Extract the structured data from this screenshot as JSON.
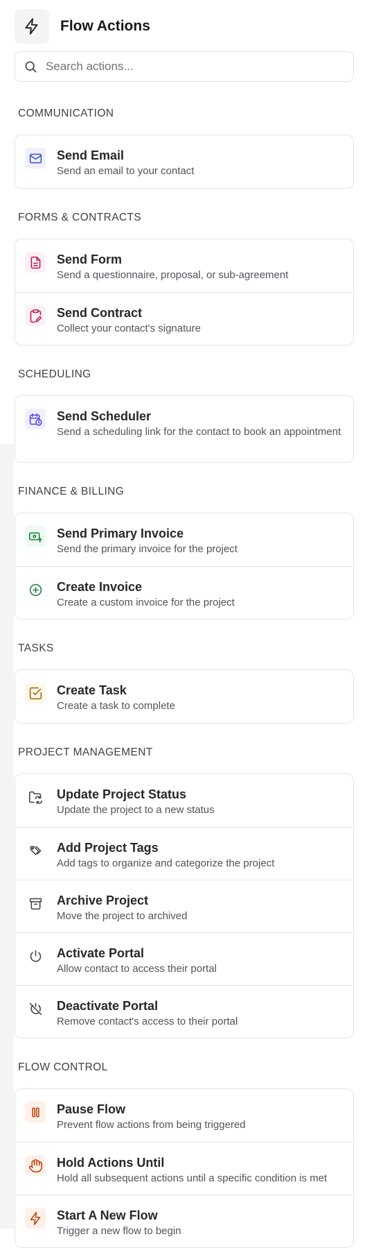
{
  "header": {
    "title": "Flow Actions",
    "icon": "lightning-icon"
  },
  "search": {
    "placeholder": "Search actions..."
  },
  "sections": [
    {
      "title": "COMMUNICATION",
      "items": [
        {
          "title": "Send Email",
          "desc": "Send an email to your contact",
          "icon": "mail-icon",
          "color": "#3b4fc4",
          "bg": "#eef0fb"
        }
      ]
    },
    {
      "title": "FORMS & CONTRACTS",
      "items": [
        {
          "title": "Send Form",
          "desc": "Send a questionnaire, proposal, or sub-agreement",
          "icon": "document-icon",
          "color": "#be185d",
          "bg": "#fdf0f5"
        },
        {
          "title": "Send Contract",
          "desc": "Collect your contact's signature",
          "icon": "clipboard-pen-icon",
          "color": "#be185d",
          "bg": "#fdf0f5"
        }
      ]
    },
    {
      "title": "SCHEDULING",
      "items": [
        {
          "title": "Send Scheduler",
          "desc": "Send a scheduling link for the contact to book an appointment",
          "icon": "calendar-clock-icon",
          "color": "#4f46e5",
          "bg": "#f0effc"
        }
      ]
    },
    {
      "title": "FINANCE & BILLING",
      "items": [
        {
          "title": "Send Primary Invoice",
          "desc": "Send the primary invoice for the project",
          "icon": "money-send-icon",
          "color": "#15803d",
          "bg": "#eefaf1"
        },
        {
          "title": "Create Invoice",
          "desc": "Create a custom invoice for the project",
          "icon": "circle-plus-icon",
          "color": "#15803d",
          "bg": "#ffffff"
        }
      ]
    },
    {
      "title": "TASKS",
      "items": [
        {
          "title": "Create Task",
          "desc": "Create a task to complete",
          "icon": "square-check-icon",
          "color": "#a16207",
          "bg": "#fbf8ea"
        }
      ]
    },
    {
      "title": "PROJECT MANAGEMENT",
      "items": [
        {
          "title": "Update Project Status",
          "desc": "Update the project to a new status",
          "icon": "folder-sync-icon",
          "color": "#3f3f46",
          "bg": "#ffffff"
        },
        {
          "title": "Add Project Tags",
          "desc": "Add tags to organize and categorize the project",
          "icon": "tags-icon",
          "color": "#3f3f46",
          "bg": "#ffffff"
        },
        {
          "title": "Archive Project",
          "desc": "Move the project to archived",
          "icon": "archive-icon",
          "color": "#3f3f46",
          "bg": "#ffffff"
        },
        {
          "title": "Activate Portal",
          "desc": "Allow contact to access their portal",
          "icon": "power-icon",
          "color": "#3f3f46",
          "bg": "#ffffff"
        },
        {
          "title": "Deactivate Portal",
          "desc": "Remove contact's access to their portal",
          "icon": "power-off-icon",
          "color": "#3f3f46",
          "bg": "#ffffff"
        }
      ]
    },
    {
      "title": "FLOW CONTROL",
      "items": [
        {
          "title": "Pause Flow",
          "desc": "Prevent flow actions from being triggered",
          "icon": "pause-icon",
          "color": "#c2410c",
          "bg": "#fdf1ea"
        },
        {
          "title": "Hold Actions Until",
          "desc": "Hold all subsequent actions until a specific condition is met",
          "icon": "hand-icon",
          "color": "#c2410c",
          "bg": "#fdf1ea"
        },
        {
          "title": "Start A New Flow",
          "desc": "Trigger a new flow to begin",
          "icon": "lightning-icon",
          "color": "#c2410c",
          "bg": "#fdf1ea"
        }
      ]
    }
  ]
}
